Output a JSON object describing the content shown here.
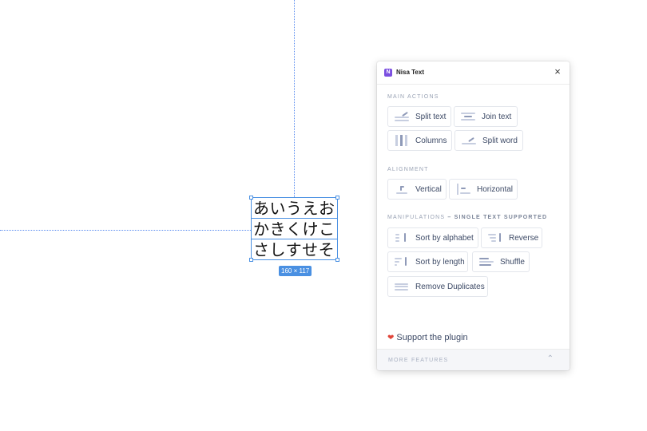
{
  "canvas": {
    "text_lines": [
      "あいうえお",
      "かきくけこ",
      "さしすせそ"
    ],
    "size_badge": "160 × 117"
  },
  "plugin": {
    "logo_letter": "N",
    "title": "Nisa Text",
    "close_icon": "×",
    "sections": {
      "main_actions": "MAIN ACTIONS",
      "alignment": "ALIGNMENT",
      "manipulations": "MANIPULATIONS",
      "manipulations_note": "– SINGLE TEXT SUPPORTED"
    },
    "buttons": {
      "split_text": "Split text",
      "join_text": "Join text",
      "columns": "Columns",
      "split_word": "Split word",
      "vertical": "Vertical",
      "horizontal": "Horizontal",
      "sort_by_alphabet": "Sort by alphabet",
      "reverse": "Reverse",
      "sort_by_length": "Sort by length",
      "shuffle": "Shuffle",
      "remove_duplicates": "Remove Duplicates"
    },
    "support": "Support the plugin",
    "heart_icon": "❤",
    "footer": "MORE FEATURES",
    "footer_chevron": "⌃",
    "colors": {
      "accent": "#4a90e2",
      "logo": "#7b4fe0",
      "heart": "#e0453a"
    }
  }
}
